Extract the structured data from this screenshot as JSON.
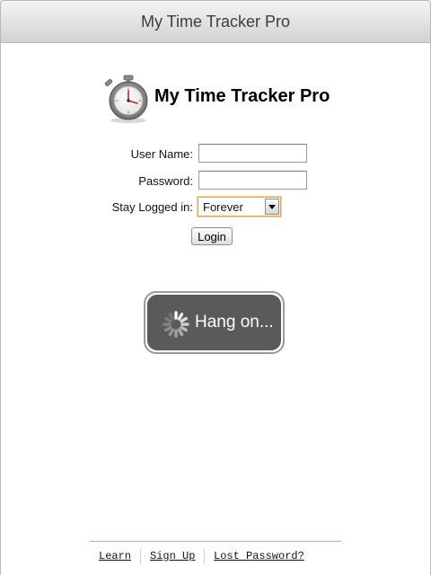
{
  "window": {
    "title": "My Time Tracker Pro"
  },
  "app": {
    "name": "My Time Tracker Pro",
    "logo_icon": "stopwatch-icon"
  },
  "form": {
    "username_label": "User Name:",
    "username_value": "",
    "password_label": "Password:",
    "password_value": "",
    "stay_logged_label": "Stay Logged in:",
    "stay_logged_value": "Forever",
    "login_label": "Login"
  },
  "loading": {
    "text": "Hang on...",
    "icon": "spinner-icon"
  },
  "footer": {
    "links": [
      "Learn",
      "Sign Up",
      "Lost Password?"
    ]
  },
  "colors": {
    "overlay_bg": "#5a5a5a",
    "select_focus": "#e3a24a",
    "footer_rule": "#9ab2c8"
  }
}
